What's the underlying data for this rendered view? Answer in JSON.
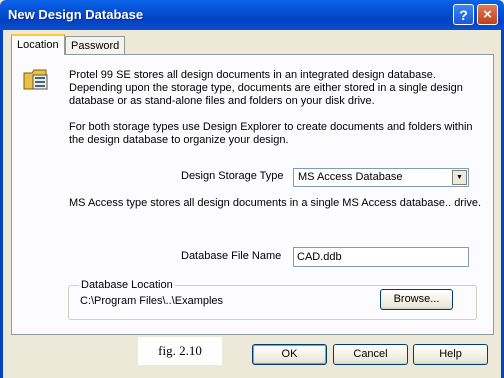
{
  "window": {
    "title": "New Design Database",
    "help_glyph": "?",
    "close_glyph": "×"
  },
  "tabs": [
    {
      "label": "Location",
      "active": true
    },
    {
      "label": "Password",
      "active": false
    }
  ],
  "location": {
    "icon": "database-folder-icon",
    "intro": "Protel 99 SE stores all design documents in an integrated design database. Depending upon the storage type, documents are either stored in a single design database or as stand-alone files and folders on your disk drive.",
    "explorer_note": "For both storage types use Design Explorer to create documents and folders within the design database to organize your design.",
    "storage_type_label": "Design Storage Type",
    "storage_type_value": "MS Access Database",
    "storage_description": "MS Access type stores all design documents in a single MS Access database.. drive.",
    "file_name_label": "Database File Name",
    "file_name_value": "CAD.ddb",
    "location_group_label": "Database Location",
    "location_path": "C:\\Program Files\\..\\Examples",
    "browse_label": "Browse..."
  },
  "footer": {
    "figure_caption": "fig. 2.10",
    "ok_label": "OK",
    "cancel_label": "Cancel",
    "help_label": "Help"
  }
}
